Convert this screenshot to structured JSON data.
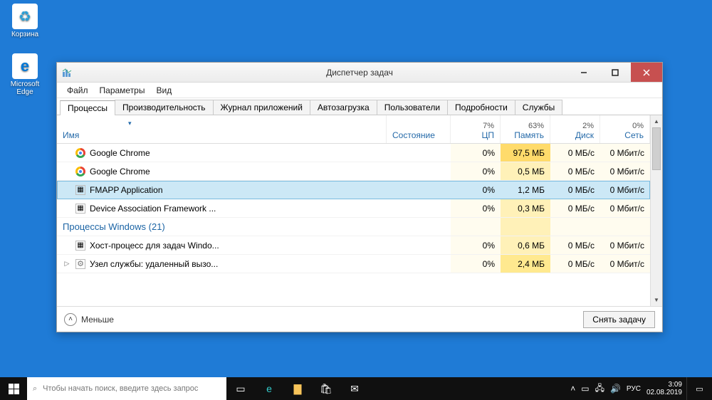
{
  "desktop": {
    "recycle_label": "Корзина",
    "edge_label": "Microsoft Edge"
  },
  "window": {
    "title": "Диспетчер задач",
    "menu": {
      "file": "Файл",
      "options": "Параметры",
      "view": "Вид"
    },
    "tabs": {
      "processes": "Процессы",
      "performance": "Производительность",
      "app_history": "Журнал приложений",
      "startup": "Автозагрузка",
      "users": "Пользователи",
      "details": "Подробности",
      "services": "Службы"
    },
    "columns": {
      "name": "Имя",
      "status": "Состояние",
      "cpu_pct": "7%",
      "cpu": "ЦП",
      "mem_pct": "63%",
      "mem": "Память",
      "disk_pct": "2%",
      "disk": "Диск",
      "net_pct": "0%",
      "net": "Сеть"
    },
    "rows": [
      {
        "icon": "chrome",
        "name": "Google Chrome",
        "cpu": "0%",
        "mem": "97,5 МБ",
        "disk": "0 МБ/с",
        "net": "0 Мбит/с",
        "mem_heat": 3
      },
      {
        "icon": "chrome",
        "name": "Google Chrome",
        "cpu": "0%",
        "mem": "0,5 МБ",
        "disk": "0 МБ/с",
        "net": "0 Мбит/с",
        "mem_heat": 1
      },
      {
        "icon": "app",
        "name": "FMAPP Application",
        "cpu": "0%",
        "mem": "1,2 МБ",
        "disk": "0 МБ/с",
        "net": "0 Мбит/с",
        "mem_heat": 1,
        "selected": true
      },
      {
        "icon": "app",
        "name": "Device Association Framework ...",
        "cpu": "0%",
        "mem": "0,3 МБ",
        "disk": "0 МБ/с",
        "net": "0 Мбит/с",
        "mem_heat": 1
      }
    ],
    "group_label": "Процессы Windows (21)",
    "rows2": [
      {
        "icon": "app",
        "name": "Хост-процесс для задач Windo...",
        "cpu": "0%",
        "mem": "0,6 МБ",
        "disk": "0 МБ/с",
        "net": "0 Мбит/с",
        "mem_heat": 1
      },
      {
        "icon": "gear",
        "expander": "▷",
        "name": "Узел службы: удаленный вызо...",
        "cpu": "0%",
        "mem": "2,4 МБ",
        "disk": "0 МБ/с",
        "net": "0 Мбит/с",
        "mem_heat": 2
      }
    ],
    "fewer": "Меньше",
    "end_task": "Снять задачу"
  },
  "taskbar": {
    "search_placeholder": "Чтобы начать поиск, введите здесь запрос",
    "lang": "РУС",
    "time": "3:09",
    "date": "02.08.2019"
  }
}
